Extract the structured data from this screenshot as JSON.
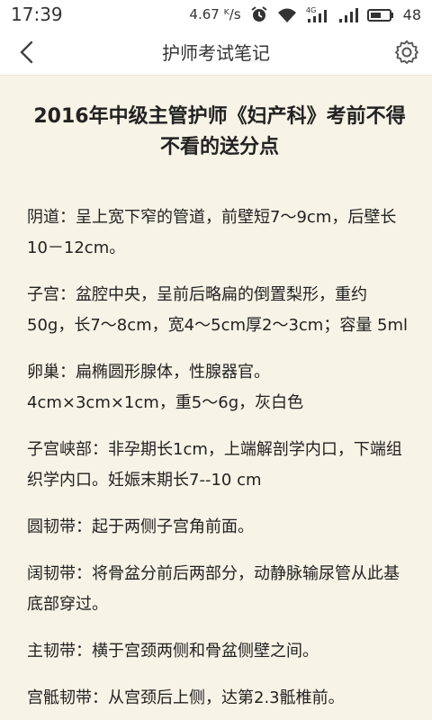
{
  "status": {
    "time": "17:39",
    "speed": "4.67 ᴷ/s",
    "network": "4G",
    "battery": "48"
  },
  "header": {
    "title": "护师考试笔记"
  },
  "article": {
    "title": "2016年中级主管护师《妇产科》考前不得不看的送分点",
    "paragraphs": [
      "阴道：呈上宽下窄的管道，前壁短7～9cm，后壁长10－12cm。",
      "子宫：盆腔中央，呈前后略扁的倒置梨形，重约50g，长7～8cm，宽4～5cm厚2～3cm；容量 5ml",
      "卵巢：扁椭圆形腺体，性腺器官。4cm×3cm×1cm，重5～6g，灰白色",
      "子宫峡部：非孕期长1cm，上端解剖学内口，下端组织学内口。妊娠末期长7--10 cm",
      "圆韧带：起于两侧子宫角前面。",
      "阔韧带：将骨盆分前后两部分，动静脉输尿管从此基底部穿过。",
      "主韧带：横于宫颈两侧和骨盆侧壁之间。",
      "宫骶韧带：从宫颈后上侧，达第2.3骶椎前。"
    ]
  }
}
